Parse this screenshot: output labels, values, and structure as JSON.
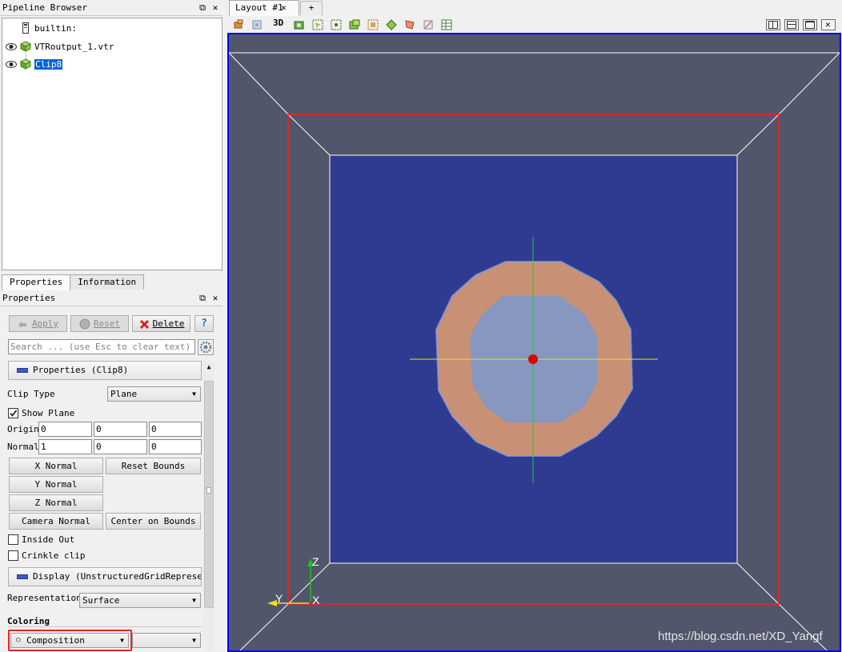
{
  "pipeline_browser": {
    "title": "Pipeline Browser",
    "items": [
      {
        "label": "builtin:"
      },
      {
        "label": "VTRoutput_1.vtr"
      },
      {
        "label": "Clip8"
      }
    ]
  },
  "tabs": {
    "properties": "Properties",
    "information": "Information"
  },
  "properties_panel": {
    "title": "Properties",
    "apply": "Apply",
    "reset": "Reset",
    "delete": "Delete",
    "help": "?",
    "search_placeholder": "Search ... (use Esc to clear text)",
    "section_properties": "Properties (Clip8)",
    "clip_type_label": "Clip Type",
    "clip_type_value": "Plane",
    "show_plane_label": "Show Plane",
    "origin_label": "Origin",
    "origin": [
      "0",
      "0",
      "0"
    ],
    "normal_label": "Normal",
    "normal": [
      "1",
      "0",
      "0"
    ],
    "x_normal": "X Normal",
    "y_normal": "Y Normal",
    "z_normal": "Z Normal",
    "reset_bounds": "Reset Bounds",
    "camera_normal": "Camera Normal",
    "center_on_bounds": "Center on Bounds",
    "inside_out_label": "Inside Out",
    "crinkle_clip_label": "Crinkle clip",
    "section_display": "Display (UnstructuredGridRepresen",
    "representation_label": "Representation",
    "representation_value": "Surface",
    "coloring_label": "Coloring",
    "coloring_value": "Composition",
    "coloring_component": ""
  },
  "layout": {
    "tab_label": "Layout #1",
    "new_tab": "+",
    "view_3d": "3D"
  },
  "axes": {
    "x": "X",
    "y": "Y",
    "z": "Z"
  },
  "watermark": "https://blog.csdn.net/XD_Yangf",
  "icons": [
    "eye-icon",
    "cube-icon",
    "server-icon",
    "close-icon",
    "undock-icon",
    "gear-icon",
    "help-icon",
    "reset-icon",
    "delete-icon",
    "apply-icon",
    "camera-icon",
    "split-horizontal-icon",
    "split-vertical-icon",
    "maximize-icon"
  ],
  "colors": {
    "viewport_bg": "#52566b",
    "slice_bg": "#2e3b91",
    "ring": "#c89075",
    "inner": "#8797c0",
    "selection": "#0a64d0",
    "highlight": "#e8261f"
  }
}
